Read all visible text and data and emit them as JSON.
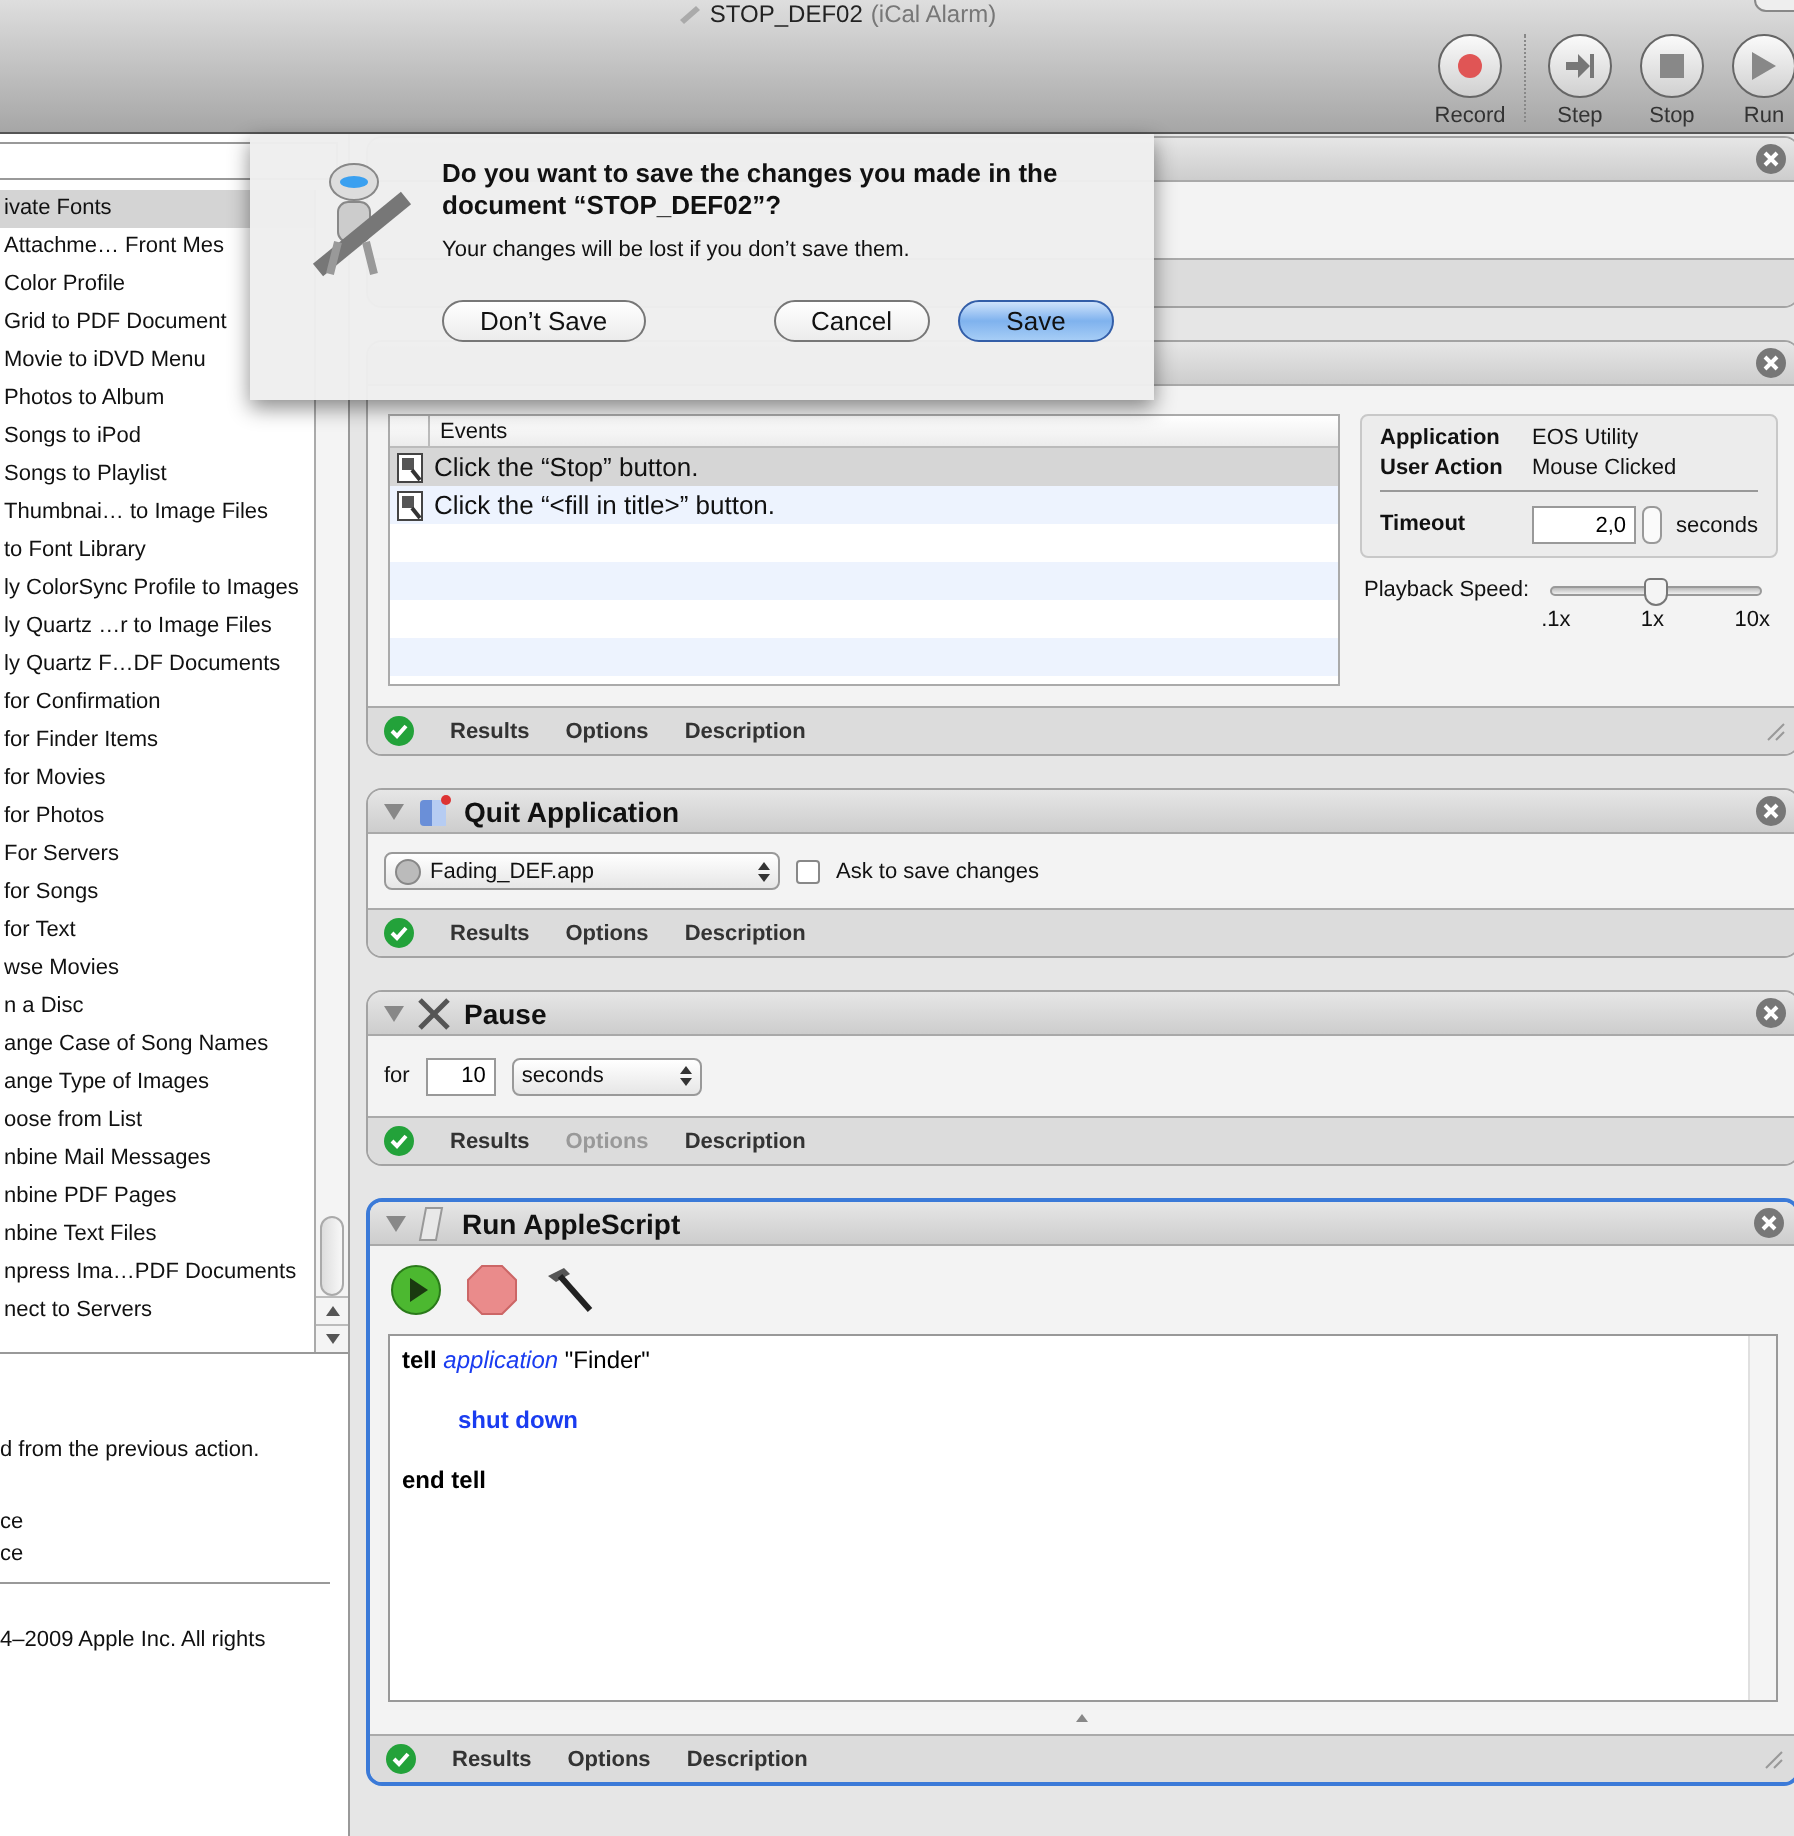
{
  "window": {
    "title": "STOP_DEF02",
    "subtitle": "(iCal Alarm)"
  },
  "toolbar": {
    "buttons": [
      {
        "kind": "record",
        "label": "Record"
      },
      {
        "kind": "step",
        "label": "Step"
      },
      {
        "kind": "stop",
        "label": "Stop"
      },
      {
        "kind": "run",
        "label": "Run"
      }
    ]
  },
  "library": {
    "items": [
      {
        "label": "ivate Fonts",
        "selected": true
      },
      {
        "label": "Attachme… Front Mes",
        "selected": false
      },
      {
        "label": "Color Profile",
        "selected": false
      },
      {
        "label": "Grid to PDF Document",
        "selected": false
      },
      {
        "label": "Movie to iDVD Menu",
        "selected": false
      },
      {
        "label": "Photos to Album",
        "selected": false
      },
      {
        "label": "Songs to iPod",
        "selected": false
      },
      {
        "label": "Songs to Playlist",
        "selected": false
      },
      {
        "label": "Thumbnai… to Image Files",
        "selected": false
      },
      {
        "label": "to Font Library",
        "selected": false
      },
      {
        "label": "ly ColorSync Profile to Images",
        "selected": false
      },
      {
        "label": "ly Quartz …r to Image Files",
        "selected": false
      },
      {
        "label": "ly Quartz F…DF Documents",
        "selected": false
      },
      {
        "label": "for Confirmation",
        "selected": false
      },
      {
        "label": "for Finder Items",
        "selected": false
      },
      {
        "label": "for Movies",
        "selected": false
      },
      {
        "label": "for Photos",
        "selected": false
      },
      {
        "label": "For Servers",
        "selected": false
      },
      {
        "label": "for Songs",
        "selected": false
      },
      {
        "label": "for Text",
        "selected": false
      },
      {
        "label": "wse Movies",
        "selected": false
      },
      {
        "label": "n a Disc",
        "selected": false
      },
      {
        "label": "ange Case of Song Names",
        "selected": false
      },
      {
        "label": "ange Type of Images",
        "selected": false
      },
      {
        "label": "oose from List",
        "selected": false
      },
      {
        "label": "nbine Mail Messages",
        "selected": false
      },
      {
        "label": "nbine PDF Pages",
        "selected": false
      },
      {
        "label": "nbine Text Files",
        "selected": false
      },
      {
        "label": "npress Ima…PDF Documents",
        "selected": false
      },
      {
        "label": "nect to Servers",
        "selected": false
      }
    ]
  },
  "description": {
    "intro": "d from the previous action.",
    "lines": [
      "ce",
      "ce"
    ],
    "copyright": "4–2009 Apple Inc. All rights"
  },
  "workflow": {
    "actions": [
      {
        "kind": "launch",
        "selected": false
      },
      {
        "kind": "watch",
        "selected": false,
        "events_header": "Events",
        "events": [
          {
            "text": "Click the “Stop” button.",
            "selected": true
          },
          {
            "text": "Click the “<fill in title>” button.",
            "selected": false
          }
        ],
        "info": {
          "application_label": "Application",
          "application": "EOS Utility",
          "action_label": "User Action",
          "action": "Mouse Clicked",
          "timeout_label": "Timeout",
          "timeout": "2,0",
          "timeout_unit": "seconds"
        },
        "speed": {
          "label": "Playback Speed:",
          "level": 0.5,
          "ticks": [
            ".1x",
            "1x",
            "10x"
          ]
        },
        "footer": {
          "tabs": [
            {
              "label": "Results",
              "disabled": false
            },
            {
              "label": "Options",
              "disabled": false
            },
            {
              "label": "Description",
              "disabled": false
            }
          ]
        }
      },
      {
        "kind": "quit",
        "title": "Quit Application",
        "selected": false,
        "app": "Fading_DEF.app",
        "ask": {
          "label": "Ask to save changes",
          "checked": false
        },
        "footer": {
          "tabs": [
            {
              "label": "Results",
              "disabled": false
            },
            {
              "label": "Options",
              "disabled": false
            },
            {
              "label": "Description",
              "disabled": false
            }
          ]
        }
      },
      {
        "kind": "pause",
        "title": "Pause",
        "selected": false,
        "for_label": "for",
        "amount": "10",
        "unit": "seconds",
        "footer": {
          "tabs": [
            {
              "label": "Results",
              "disabled": false
            },
            {
              "label": "Options",
              "disabled": true
            },
            {
              "label": "Description",
              "disabled": false
            }
          ]
        }
      },
      {
        "kind": "script",
        "title": "Run AppleScript",
        "selected": true,
        "code": [
          {
            "indented": false,
            "parts": [
              {
                "kind": "keyword",
                "text": "tell"
              },
              {
                "kind": "class",
                "text": "application"
              },
              {
                "kind": "plain",
                "text": "\"Finder\""
              }
            ]
          },
          {
            "indented": true,
            "parts": [
              {
                "kind": "command",
                "text": "shut down"
              }
            ]
          },
          {
            "indented": false,
            "parts": [
              {
                "kind": "keyword",
                "text": "end tell"
              }
            ]
          }
        ],
        "footer": {
          "tabs": [
            {
              "label": "Results",
              "disabled": false
            },
            {
              "label": "Options",
              "disabled": false
            },
            {
              "label": "Description",
              "disabled": false
            }
          ]
        }
      }
    ]
  },
  "dialog": {
    "message": "Do you want to save the changes you made in the document “STOP_DEF02”?",
    "detail": "Your changes will be lost if you don’t save them.",
    "buttons": [
      {
        "label": "Don’t Save",
        "default": false
      },
      {
        "label": "Cancel",
        "default": false
      },
      {
        "label": "Save",
        "default": true
      }
    ]
  }
}
